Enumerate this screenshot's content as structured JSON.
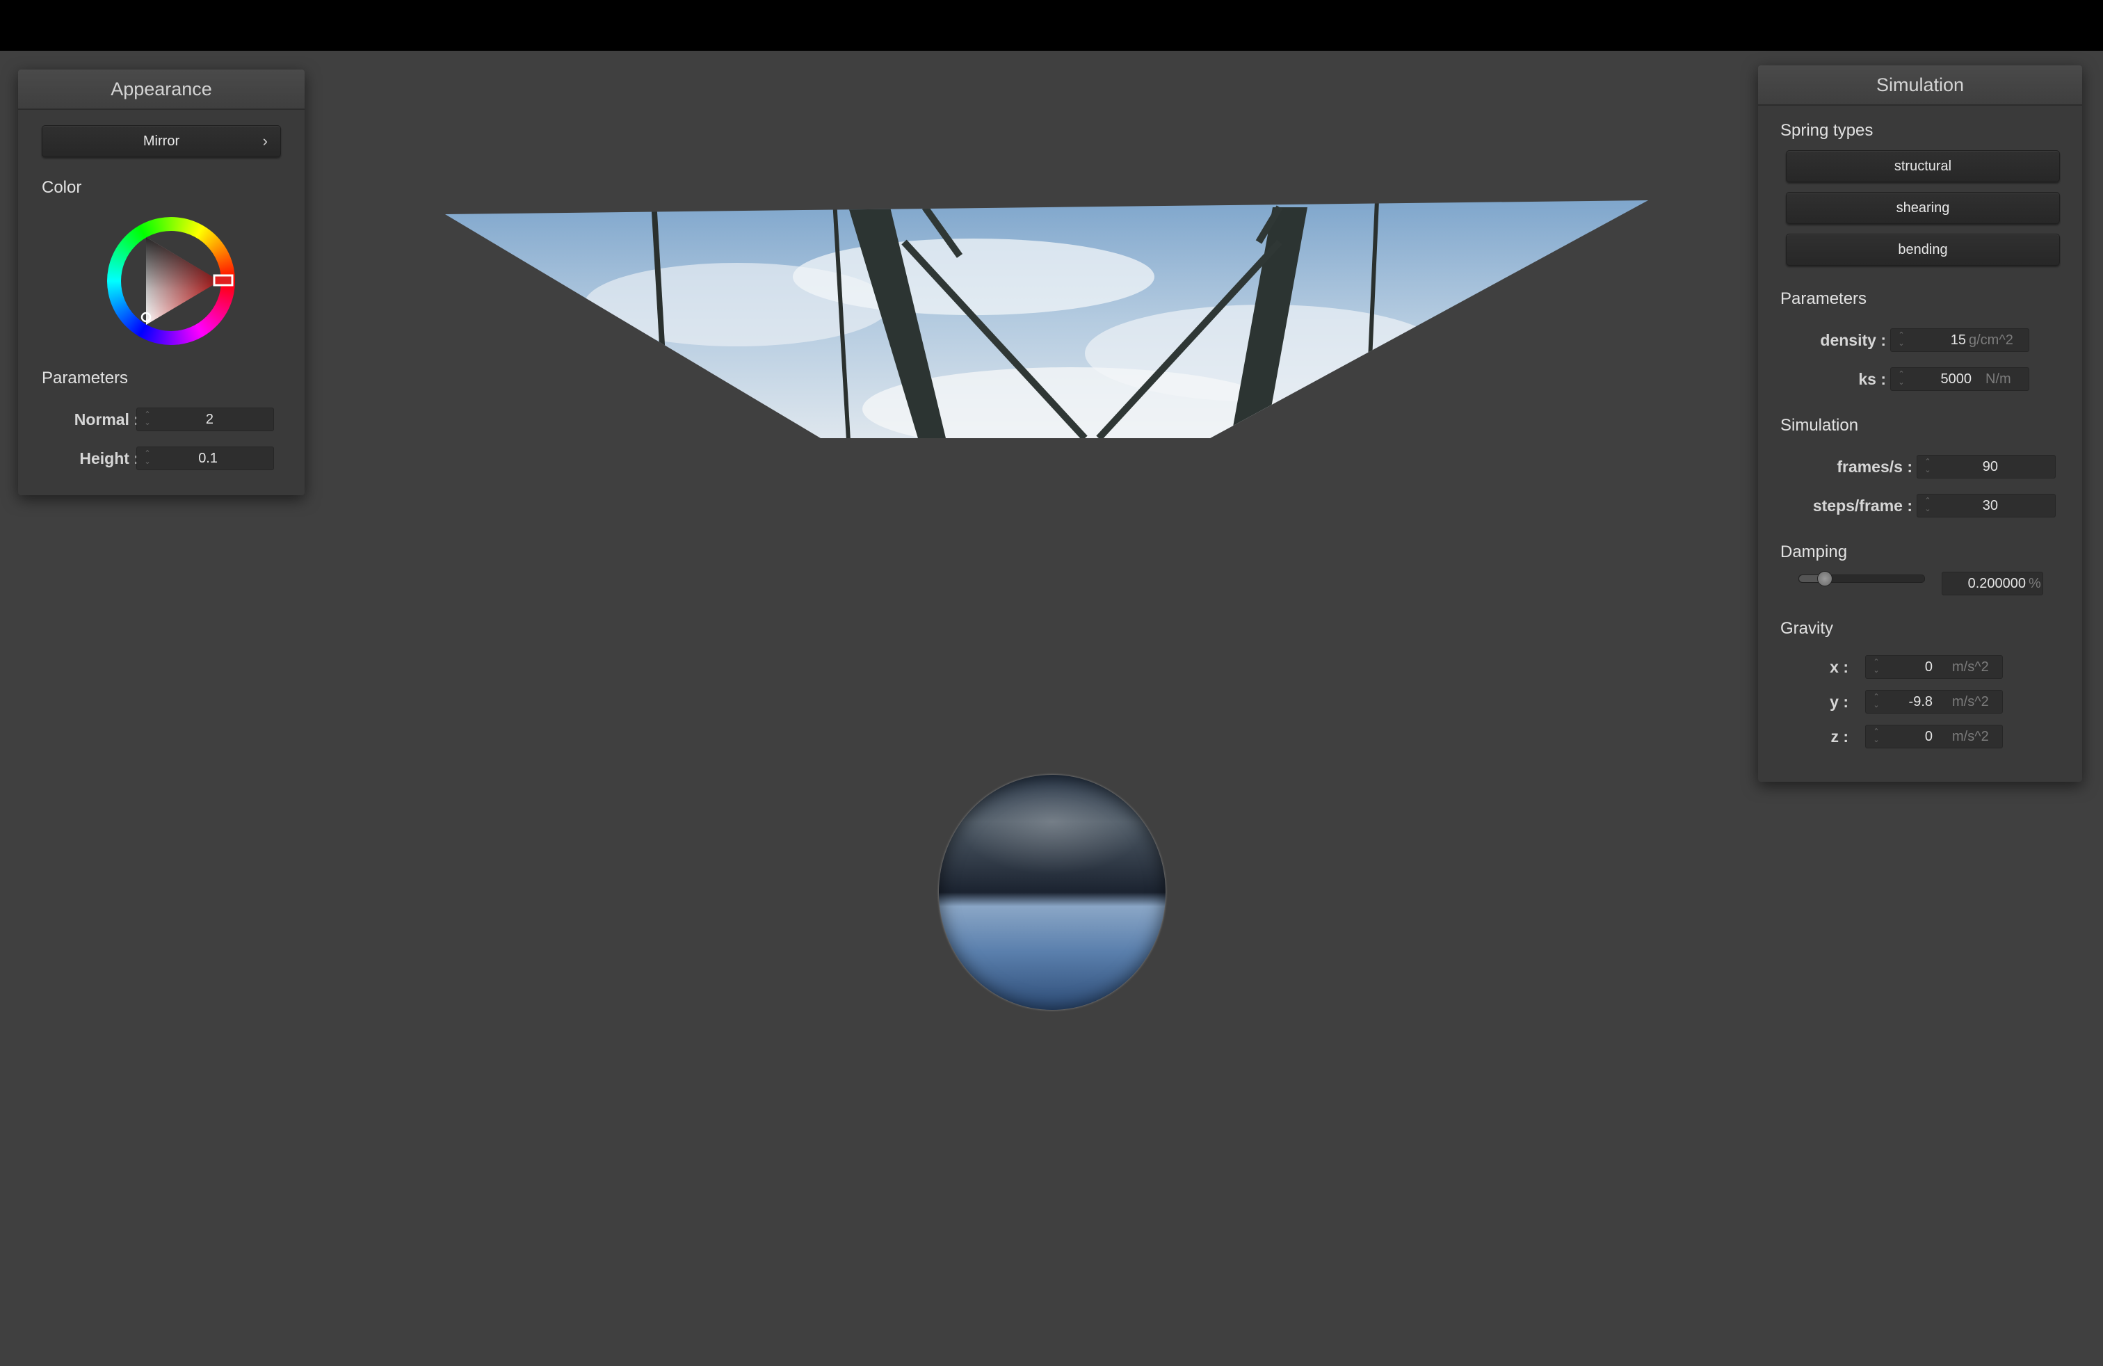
{
  "appearance": {
    "title": "Appearance",
    "material": "Mirror",
    "color_label": "Color",
    "params_label": "Parameters",
    "normal_label": "Normal :",
    "normal_value": "2",
    "height_label": "Height :",
    "height_value": "0.1"
  },
  "simulation": {
    "title": "Simulation",
    "spring_types_label": "Spring types",
    "spring_buttons": [
      "structural",
      "shearing",
      "bending"
    ],
    "params_label": "Parameters",
    "density_label": "density :",
    "density_value": "15",
    "density_unit": "g/cm^2",
    "ks_label": "ks :",
    "ks_value": "5000",
    "ks_unit": "N/m",
    "sim_label": "Simulation",
    "fps_label": "frames/s :",
    "fps_value": "90",
    "steps_label": "steps/frame :",
    "steps_value": "30",
    "damping_label": "Damping",
    "damping_value": "0.200000",
    "damping_unit": "%",
    "damping_fraction": 0.2,
    "gravity_label": "Gravity",
    "gx_label": "x :",
    "gx_value": "0",
    "gy_label": "y :",
    "gy_value": "-9.8",
    "gz_label": "z :",
    "gz_value": "0",
    "gravity_unit": "m/s^2"
  },
  "colors": {
    "background": "#404040",
    "panel": "#3a3a3a",
    "selected_color": "#cc2222"
  }
}
